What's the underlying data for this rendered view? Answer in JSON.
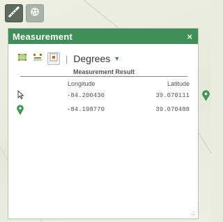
{
  "colors": {
    "header_green": "#3f8f58",
    "pin_green": "#3f9a57",
    "link_blue": "#3d7bbf"
  },
  "toolbar": {
    "measure_tool": "ruler-icon",
    "other_tool": "palette-icon"
  },
  "panel": {
    "title": "Measurement",
    "close_label": "×",
    "unit": "Degrees",
    "result_header": "Measurement Result",
    "col_longitude": "Longitude",
    "col_latitude": "Latitude",
    "rows": [
      {
        "icon": "cursor-icon",
        "longitude": "-84.200436",
        "latitude": "39.070111"
      },
      {
        "icon": "map-pin-icon",
        "longitude": "-84.198770",
        "latitude": "39.070488"
      }
    ],
    "resize_label": ".::"
  }
}
